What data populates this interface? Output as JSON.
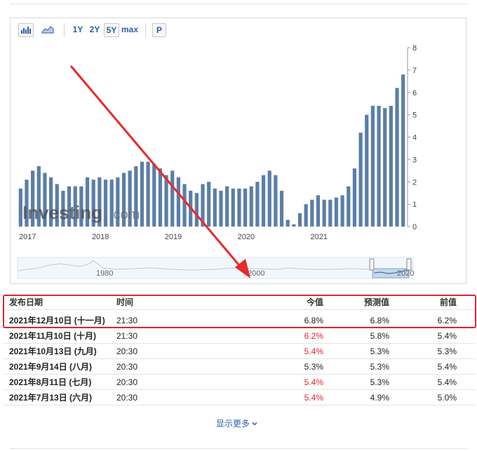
{
  "toolbar": {
    "bar_icon": "bar-chart-icon",
    "area_icon": "area-chart-icon",
    "ranges": [
      "1Y",
      "2Y",
      "5Y",
      "max"
    ],
    "selected_range": "5Y",
    "popup_label": "P"
  },
  "watermark": {
    "brand": "Investing",
    "suffix": ".com"
  },
  "navigator": {
    "labels": [
      "1980",
      "2000",
      "2020"
    ]
  },
  "chart_data": {
    "type": "bar",
    "ylim": [
      0,
      8
    ],
    "yticks": [
      0,
      1,
      2,
      3,
      4,
      5,
      6,
      7,
      8
    ],
    "grid": false,
    "year_labels": [
      "2017",
      "2018",
      "2019",
      "2020",
      "2021"
    ],
    "values": [
      1.7,
      2.1,
      2.5,
      2.7,
      2.4,
      2.2,
      1.9,
      1.6,
      1.8,
      1.8,
      1.8,
      2.2,
      2.1,
      2.2,
      2.1,
      2.1,
      2.2,
      2.4,
      2.5,
      2.7,
      2.9,
      2.9,
      2.8,
      2.6,
      2.3,
      2.5,
      2.2,
      1.9,
      1.6,
      1.5,
      1.9,
      2.0,
      1.7,
      1.6,
      1.8,
      1.7,
      1.7,
      1.7,
      1.8,
      2.0,
      2.3,
      2.5,
      2.3,
      1.6,
      0.3,
      0.1,
      0.6,
      1.0,
      1.2,
      1.4,
      1.2,
      1.2,
      1.3,
      1.4,
      1.8,
      2.6,
      4.2,
      5.0,
      5.4,
      5.4,
      5.3,
      5.4,
      6.2,
      6.8
    ]
  },
  "table": {
    "headers": {
      "date": "发布日期",
      "time": "时间",
      "actual": "今值",
      "forecast": "预测值",
      "previous": "前值"
    },
    "rows": [
      {
        "date": "2021年12月10日 (十一月)",
        "time": "21:30",
        "actual": "6.8%",
        "forecast": "6.8%",
        "previous": "6.2%",
        "actual_color": "#222222"
      },
      {
        "date": "2021年11月10日 (十月)",
        "time": "21:30",
        "actual": "6.2%",
        "forecast": "5.8%",
        "previous": "5.4%",
        "actual_color": "#e0242b"
      },
      {
        "date": "2021年10月13日 (九月)",
        "time": "20:30",
        "actual": "5.4%",
        "forecast": "5.3%",
        "previous": "5.3%",
        "actual_color": "#e0242b"
      },
      {
        "date": "2021年9月14日 (八月)",
        "time": "20:30",
        "actual": "5.3%",
        "forecast": "5.3%",
        "previous": "5.4%",
        "actual_color": "#222222"
      },
      {
        "date": "2021年8月11日 (七月)",
        "time": "20:30",
        "actual": "5.4%",
        "forecast": "5.3%",
        "previous": "5.4%",
        "actual_color": "#e0242b"
      },
      {
        "date": "2021年7月13日 (六月)",
        "time": "20:30",
        "actual": "5.4%",
        "forecast": "4.9%",
        "previous": "5.0%",
        "actual_color": "#e0242b"
      }
    ]
  },
  "show_more": {
    "label": "显示更多"
  },
  "colors": {
    "bar": "#5b7ea8",
    "accent_red": "#e0242b",
    "link": "#2a5fa8"
  }
}
